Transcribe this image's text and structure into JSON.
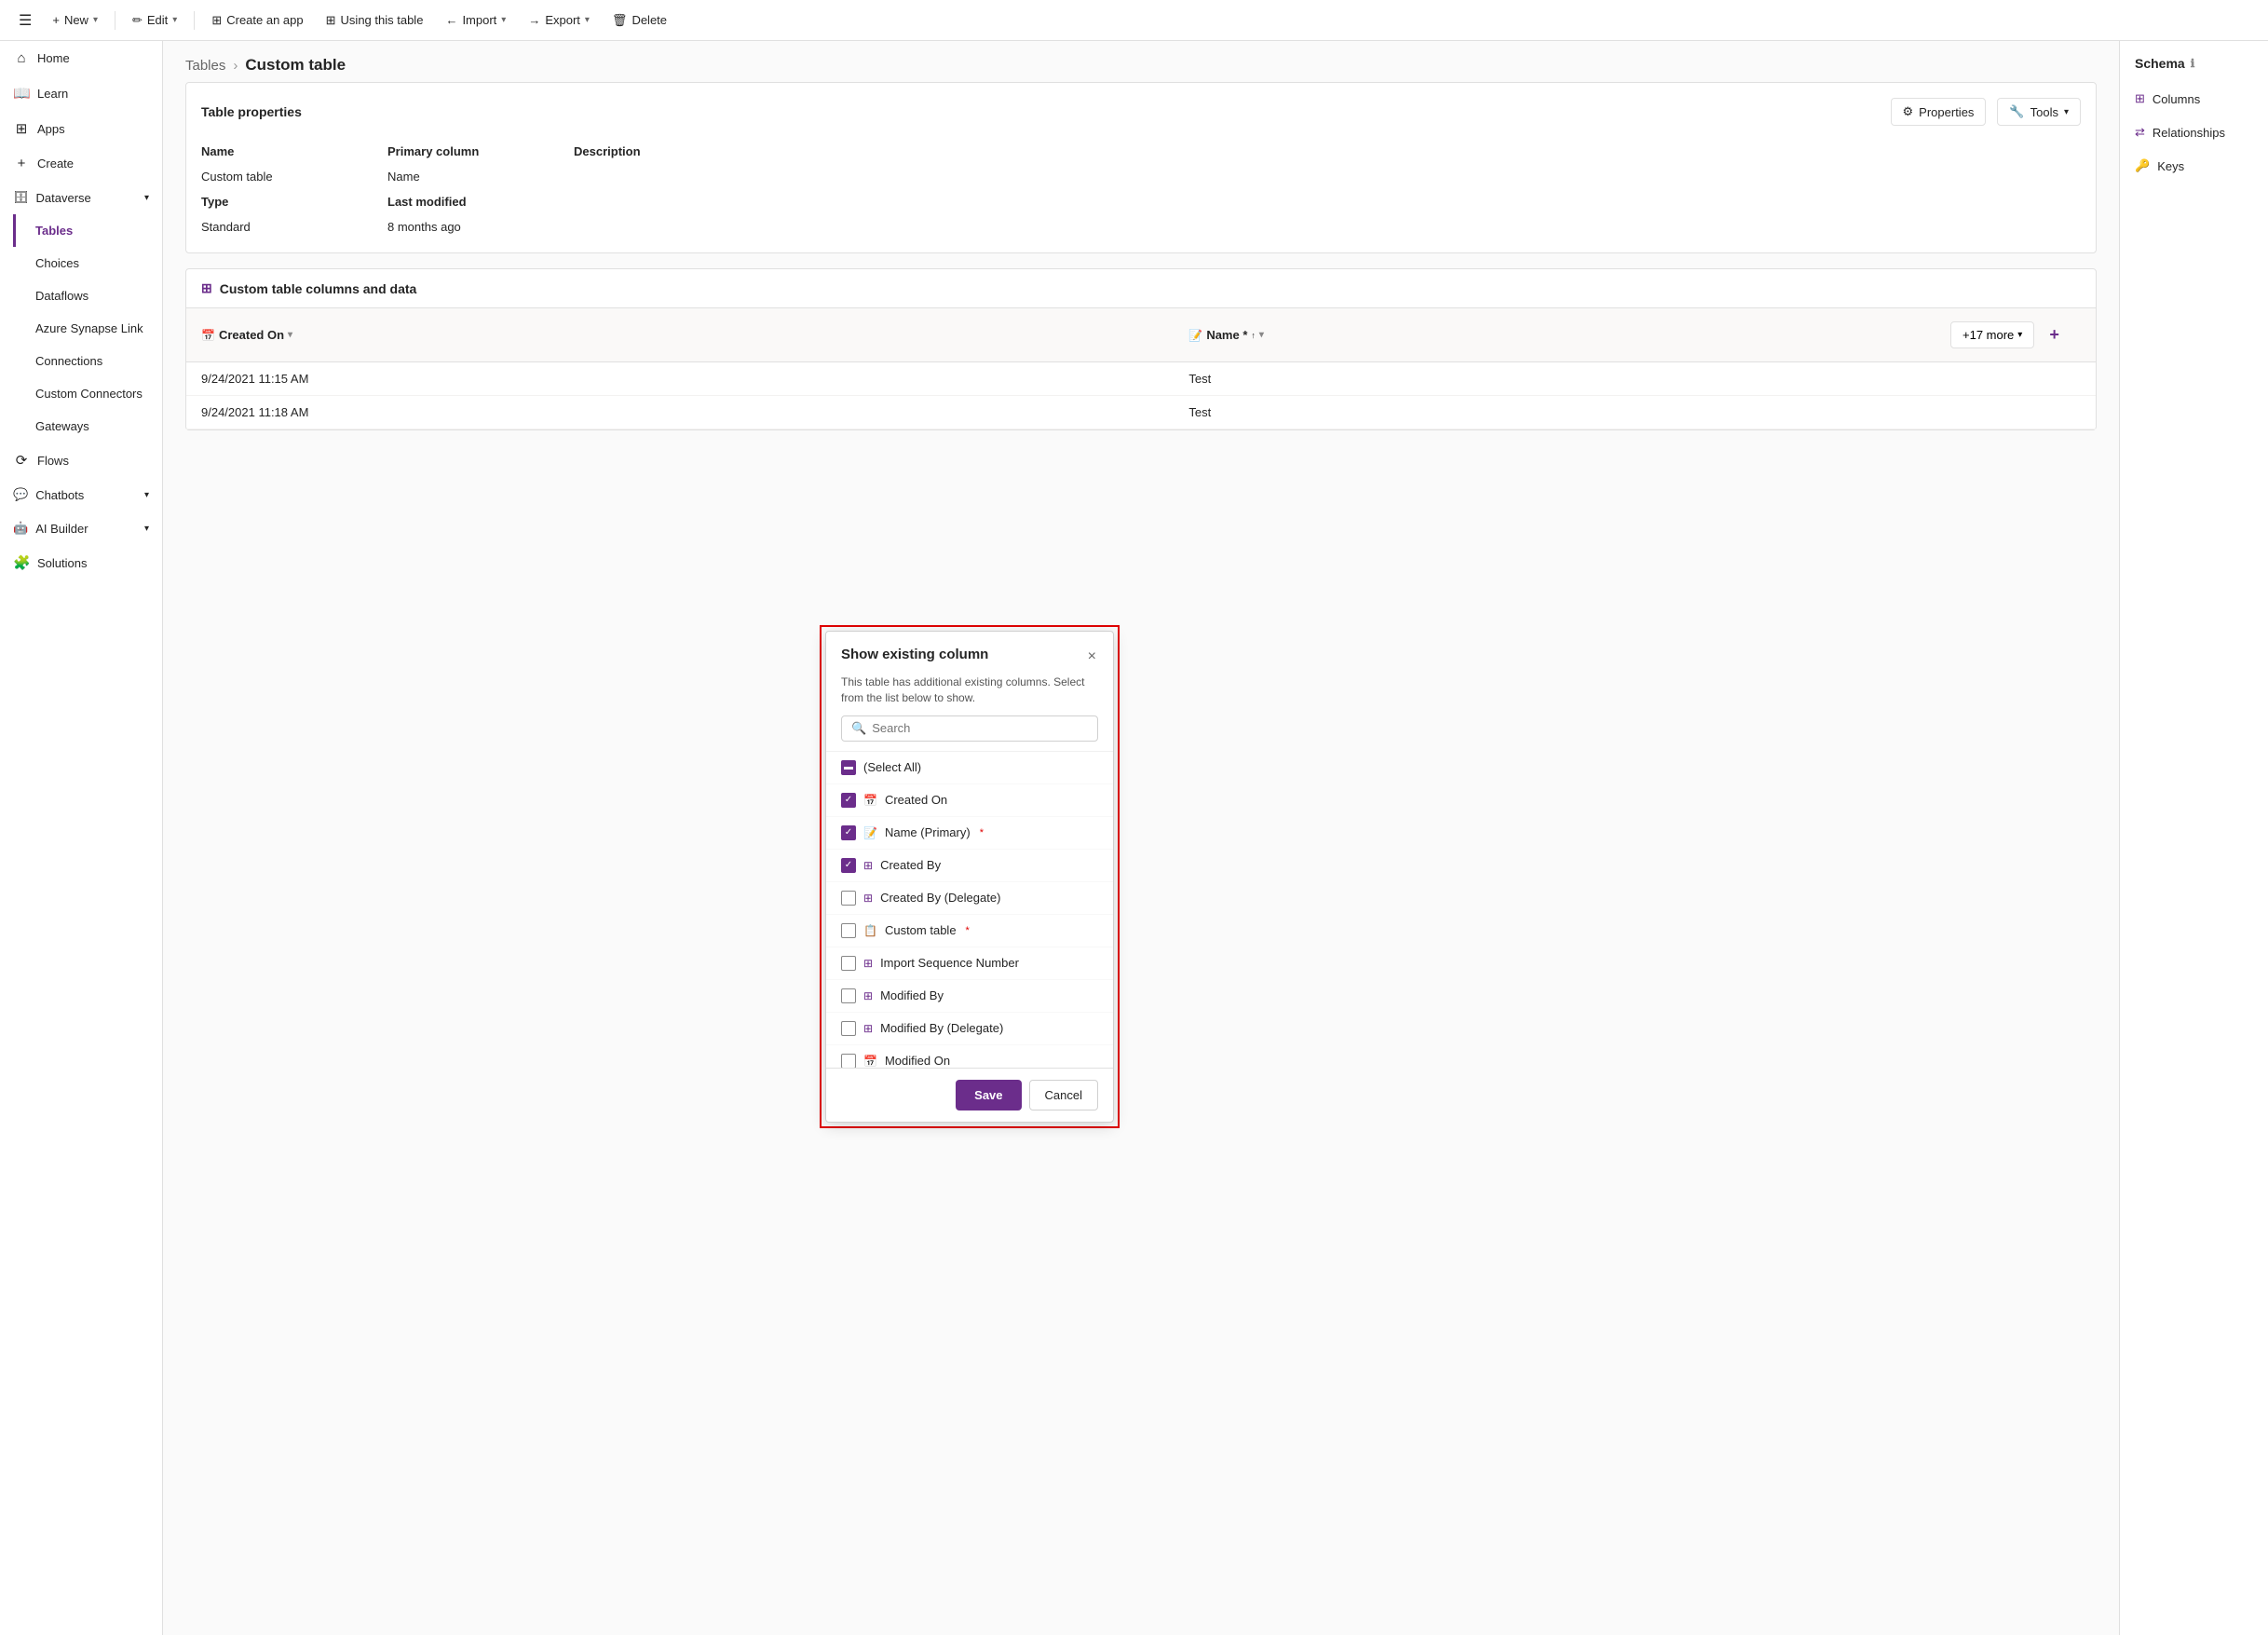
{
  "toolbar": {
    "hamburger": "☰",
    "new_label": "New",
    "edit_label": "Edit",
    "create_app_label": "Create an app",
    "using_this_table_label": "Using this table",
    "import_label": "Import",
    "export_label": "Export",
    "delete_label": "Delete"
  },
  "sidebar": {
    "items": [
      {
        "id": "home",
        "label": "Home",
        "icon": "⌂"
      },
      {
        "id": "learn",
        "label": "Learn",
        "icon": "📖"
      },
      {
        "id": "apps",
        "label": "Apps",
        "icon": "⊞"
      },
      {
        "id": "create",
        "label": "Create",
        "icon": "+"
      },
      {
        "id": "dataverse",
        "label": "Dataverse",
        "icon": "🗄",
        "expandable": true,
        "expanded": true
      },
      {
        "id": "tables",
        "label": "Tables",
        "icon": "",
        "active": true,
        "sub": true
      },
      {
        "id": "choices",
        "label": "Choices",
        "icon": "",
        "sub": true
      },
      {
        "id": "dataflows",
        "label": "Dataflows",
        "icon": "",
        "sub": true
      },
      {
        "id": "azure-synapse",
        "label": "Azure Synapse Link",
        "icon": "",
        "sub": true
      },
      {
        "id": "connections",
        "label": "Connections",
        "icon": "",
        "sub": true
      },
      {
        "id": "custom-connectors",
        "label": "Custom Connectors",
        "icon": "",
        "sub": true
      },
      {
        "id": "gateways",
        "label": "Gateways",
        "icon": "",
        "sub": true
      },
      {
        "id": "flows",
        "label": "Flows",
        "icon": "⟳"
      },
      {
        "id": "chatbots",
        "label": "Chatbots",
        "icon": "💬",
        "expandable": true
      },
      {
        "id": "ai-builder",
        "label": "AI Builder",
        "icon": "🤖",
        "expandable": true
      },
      {
        "id": "solutions",
        "label": "Solutions",
        "icon": "🧩"
      }
    ]
  },
  "breadcrumb": {
    "parent": "Tables",
    "current": "Custom table"
  },
  "table_properties": {
    "title": "Table properties",
    "properties_btn": "Properties",
    "tools_btn": "Tools",
    "rows": [
      {
        "label": "Name",
        "value": "Custom table",
        "col": 1
      },
      {
        "label": "Primary column",
        "value": "Name",
        "col": 2
      },
      {
        "label": "Description",
        "value": "",
        "col": 3
      },
      {
        "label": "Type",
        "value": "Standard",
        "col": 1
      },
      {
        "label": "Last modified",
        "value": "8 months ago",
        "col": 2
      }
    ]
  },
  "data_section": {
    "title": "Custom table columns and data",
    "columns": [
      {
        "id": "created_on",
        "label": "Created On",
        "icon": "📅"
      },
      {
        "id": "name",
        "label": "Name",
        "icon": "📝",
        "primary": true
      }
    ],
    "rows": [
      {
        "created_on": "9/24/2021 11:15 AM",
        "name": "Test"
      },
      {
        "created_on": "9/24/2021 11:18 AM",
        "name": "Test"
      }
    ],
    "more_label": "+17 more"
  },
  "schema_panel": {
    "title": "Schema",
    "items": [
      {
        "id": "columns",
        "label": "Columns",
        "icon": "⊞"
      },
      {
        "id": "relationships",
        "label": "Relationships",
        "icon": "⇄"
      },
      {
        "id": "keys",
        "label": "Keys",
        "icon": "🔑"
      }
    ]
  },
  "dialog": {
    "title": "Show existing column",
    "subtitle": "This table has additional existing columns. Select from the list below to show.",
    "search_placeholder": "Search",
    "close_btn": "×",
    "items": [
      {
        "id": "select_all",
        "label": "(Select All)",
        "checked": "partial",
        "icon": ""
      },
      {
        "id": "created_on",
        "label": "Created On",
        "checked": "checked",
        "icon": "📅"
      },
      {
        "id": "name_primary",
        "label": "Name (Primary)",
        "checked": "checked",
        "icon": "📝",
        "required": true
      },
      {
        "id": "created_by",
        "label": "Created By",
        "checked": "checked",
        "icon": "⊞"
      },
      {
        "id": "created_by_delegate",
        "label": "Created By (Delegate)",
        "checked": "unchecked",
        "icon": "⊞"
      },
      {
        "id": "custom_table",
        "label": "Custom table",
        "checked": "unchecked",
        "icon": "📋",
        "required": true
      },
      {
        "id": "import_seq",
        "label": "Import Sequence Number",
        "checked": "unchecked",
        "icon": "⊞"
      },
      {
        "id": "modified_by",
        "label": "Modified By",
        "checked": "unchecked",
        "icon": "⊞"
      },
      {
        "id": "modified_by_delegate",
        "label": "Modified By (Delegate)",
        "checked": "unchecked",
        "icon": "⊞"
      },
      {
        "id": "modified_on",
        "label": "Modified On",
        "checked": "unchecked",
        "icon": "📅"
      }
    ],
    "save_label": "Save",
    "cancel_label": "Cancel"
  },
  "colors": {
    "accent": "#6B2D8B",
    "red_border": "#e00000"
  }
}
